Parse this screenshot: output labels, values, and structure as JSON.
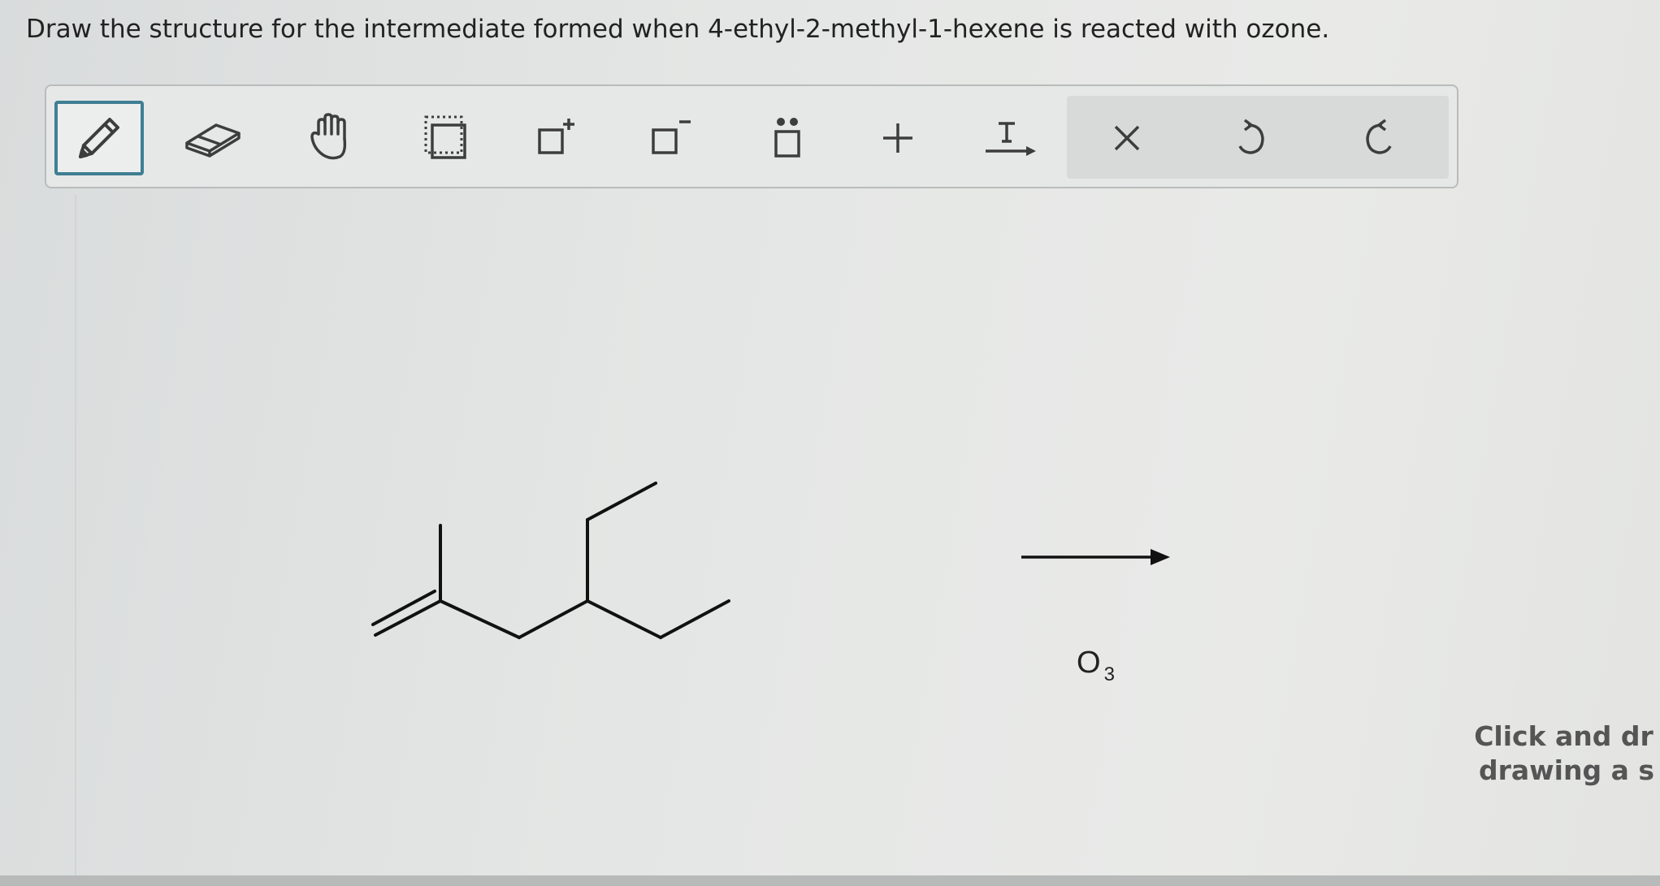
{
  "question": "Draw the structure for the intermediate formed when 4-ethyl-2-methyl-1-hexene is reacted with ozone.",
  "toolbar": {
    "tools": [
      {
        "name": "pencil-icon",
        "active": true
      },
      {
        "name": "eraser-icon",
        "active": false
      },
      {
        "name": "hand-icon",
        "active": false
      },
      {
        "name": "select-box-icon",
        "active": false
      },
      {
        "name": "positive-charge-icon",
        "active": false
      },
      {
        "name": "negative-charge-icon",
        "active": false
      },
      {
        "name": "lone-pair-icon",
        "active": false
      },
      {
        "name": "plus-icon",
        "active": false
      },
      {
        "name": "text-arrow-icon",
        "active": false
      },
      {
        "name": "clear-icon",
        "active": false
      },
      {
        "name": "undo-icon",
        "active": false
      },
      {
        "name": "redo-icon",
        "active": false
      }
    ],
    "accent_color": "#3f7e93"
  },
  "reaction": {
    "reagent_symbol": "O",
    "reagent_subscript": "3",
    "molecule": "4-ethyl-2-methyl-1-hexene"
  },
  "drawing_hint": {
    "line1": "Click and dr",
    "line2": "drawing a s"
  }
}
